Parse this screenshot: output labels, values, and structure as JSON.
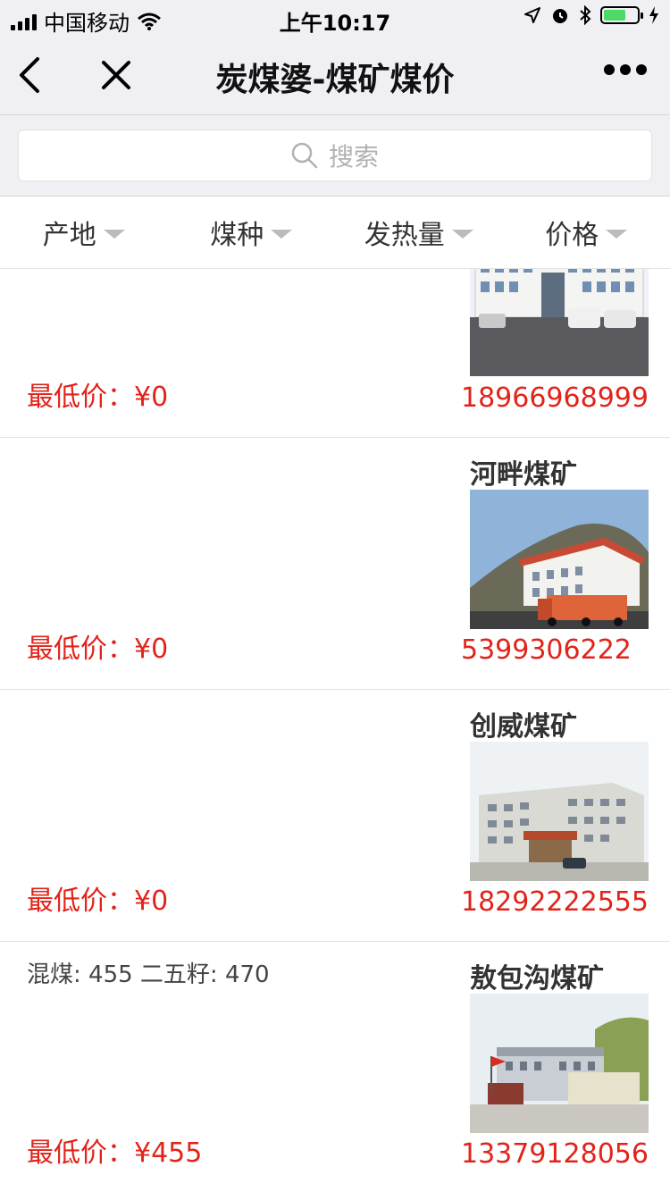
{
  "status_bar": {
    "carrier": "中国移动",
    "time": "上午10:17"
  },
  "nav": {
    "title": "炭煤婆-煤矿煤价"
  },
  "search": {
    "placeholder": "搜索"
  },
  "filters": [
    {
      "label": "产地"
    },
    {
      "label": "煤种"
    },
    {
      "label": "发热量"
    },
    {
      "label": "价格"
    }
  ],
  "cards": [
    {
      "name": "",
      "grades": "",
      "price": "最低价：¥0",
      "phone": "18966968999"
    },
    {
      "name": "河畔煤矿",
      "grades": "",
      "price": "最低价：¥0",
      "phone": "5399306222"
    },
    {
      "name": "创威煤矿",
      "grades": "",
      "price": "最低价：¥0",
      "phone": "18292222555"
    },
    {
      "name": "敖包沟煤矿",
      "grades": "混煤: 455   二五籽: 470",
      "price": "最低价：¥455",
      "phone": "13379128056"
    }
  ],
  "colors": {
    "accent_red": "#e2231a",
    "bar_bg": "#efeff4",
    "battery_green": "#4cd964"
  }
}
